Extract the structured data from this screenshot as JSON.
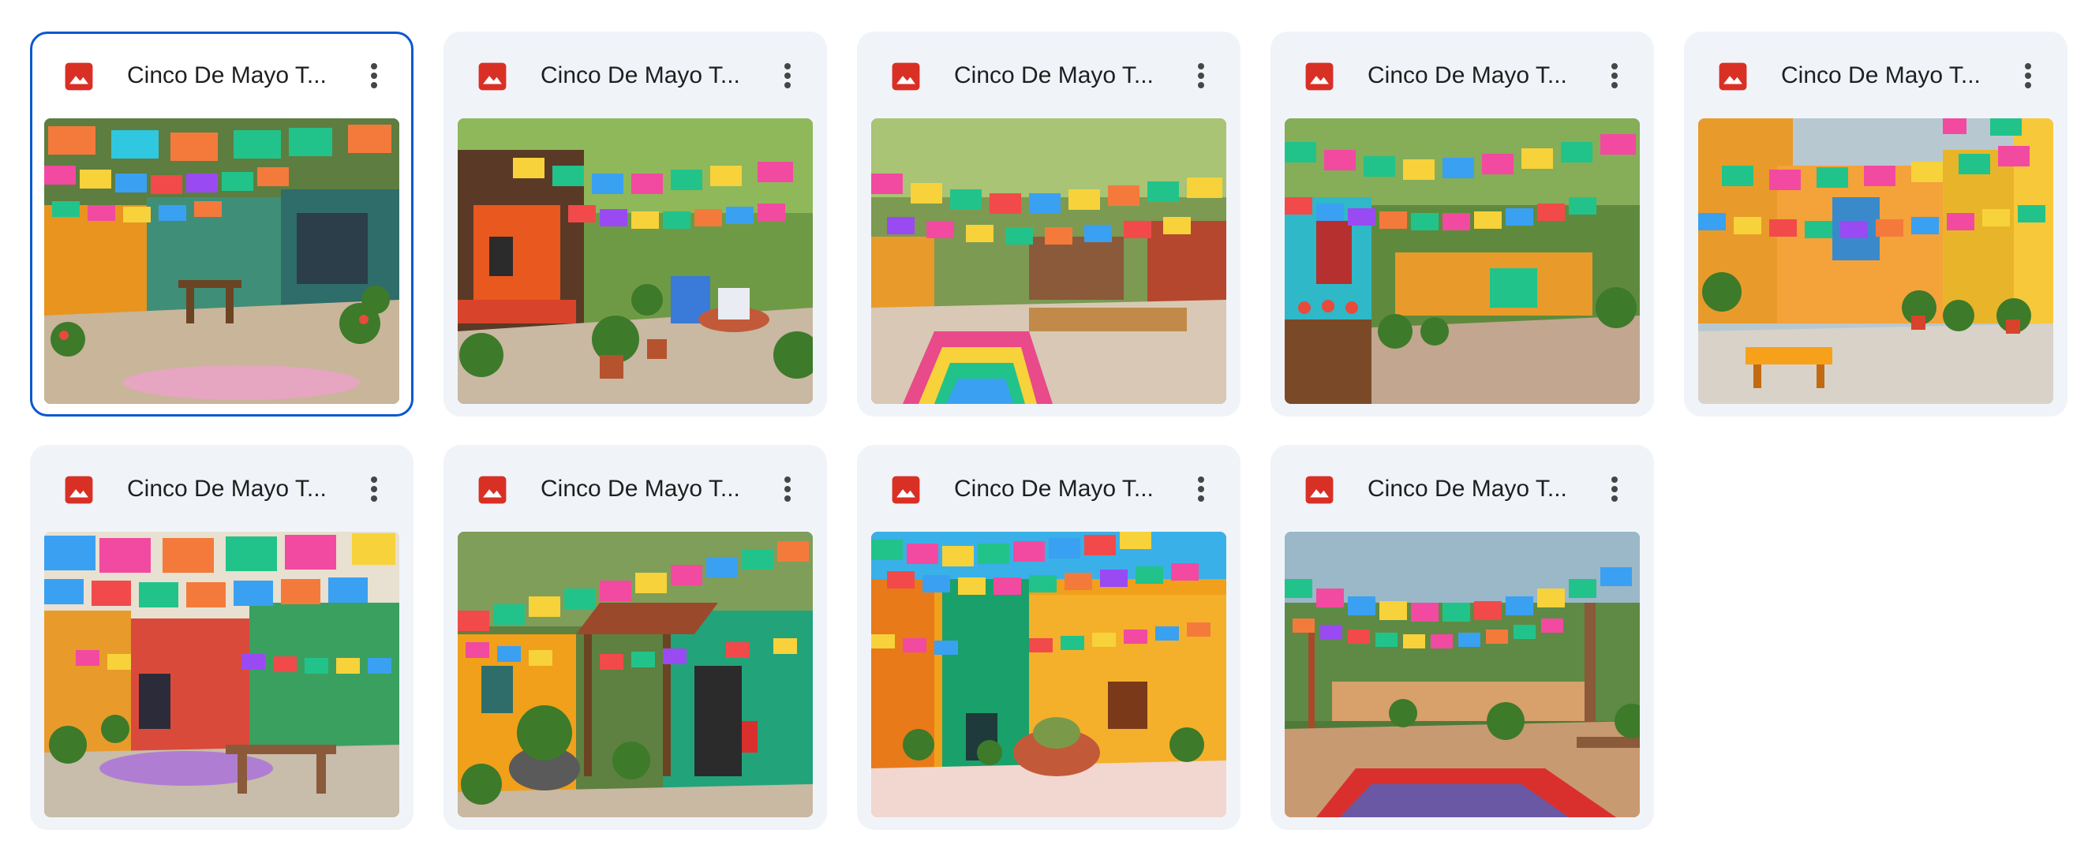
{
  "accent_color": "#0b57d0",
  "file_icon_color": "#d93025",
  "files": [
    {
      "title": "Cinco De Mayo T...",
      "selected": true,
      "icon": "image-file-icon",
      "menu_icon": "more-vert-icon"
    },
    {
      "title": "Cinco De Mayo T...",
      "selected": false,
      "icon": "image-file-icon",
      "menu_icon": "more-vert-icon"
    },
    {
      "title": "Cinco De Mayo T...",
      "selected": false,
      "icon": "image-file-icon",
      "menu_icon": "more-vert-icon"
    },
    {
      "title": "Cinco De Mayo T...",
      "selected": false,
      "icon": "image-file-icon",
      "menu_icon": "more-vert-icon"
    },
    {
      "title": "Cinco De Mayo T...",
      "selected": false,
      "icon": "image-file-icon",
      "menu_icon": "more-vert-icon"
    },
    {
      "title": "Cinco De Mayo T...",
      "selected": false,
      "icon": "image-file-icon",
      "menu_icon": "more-vert-icon"
    },
    {
      "title": "Cinco De Mayo T...",
      "selected": false,
      "icon": "image-file-icon",
      "menu_icon": "more-vert-icon"
    },
    {
      "title": "Cinco De Mayo T...",
      "selected": false,
      "icon": "image-file-icon",
      "menu_icon": "more-vert-icon"
    },
    {
      "title": "Cinco De Mayo T...",
      "selected": false,
      "icon": "image-file-icon",
      "menu_icon": "more-vert-icon"
    }
  ]
}
